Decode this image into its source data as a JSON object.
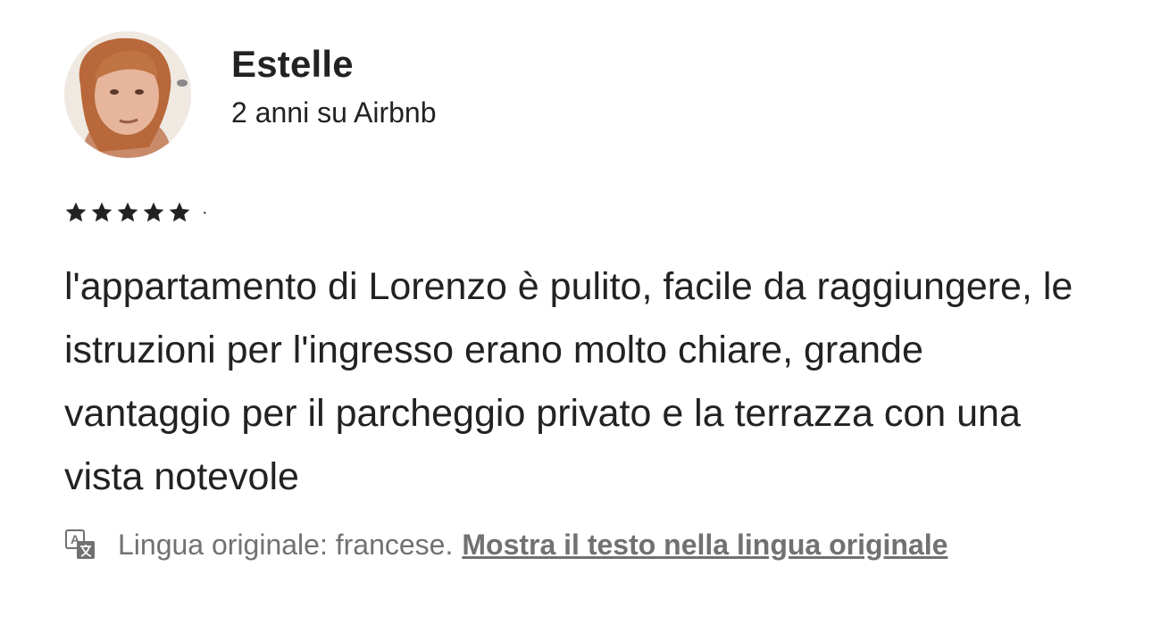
{
  "reviewer": {
    "name": "Estelle",
    "meta": "2 anni su Airbnb",
    "avatar_icon": "user-avatar-photo"
  },
  "rating": {
    "stars": 5,
    "max_stars": 5,
    "separator": "·",
    "star_icon": "star-icon",
    "star_color": "#222222"
  },
  "review": {
    "text": "l'appartamento di Lorenzo è pulito, facile da raggiungere, le istruzioni per l'ingresso erano molto chiare, grande vantaggio per il parcheggio privato e la terrazza con una vista notevole"
  },
  "translation": {
    "icon": "translate-icon",
    "note": "Lingua originale: francese.",
    "link_label": "Mostra il testo nella lingua originale",
    "text_color": "#717171"
  }
}
